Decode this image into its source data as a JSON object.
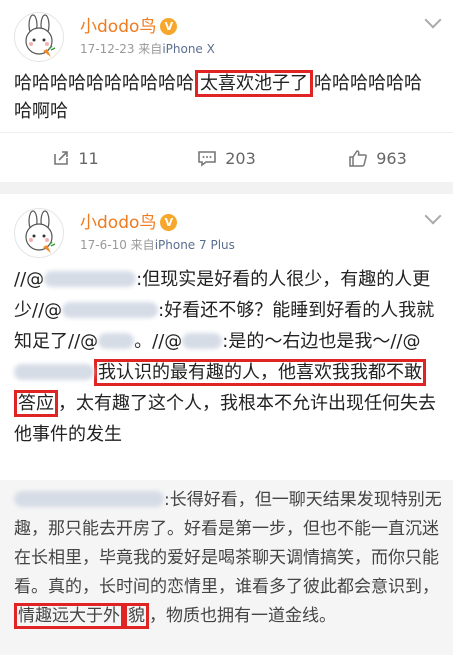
{
  "post1": {
    "user_name": "小dodo鸟",
    "date": "17-12-23",
    "source_prefix": "来自",
    "device": "iPhone X",
    "text_before": "哈哈哈哈哈哈哈哈哈哈",
    "text_highlight": "太喜欢池子了",
    "text_after": "哈哈哈哈哈哈哈啊哈",
    "repost_count": "11",
    "comment_count": "203",
    "like_count": "963"
  },
  "post2": {
    "user_name": "小dodo鸟",
    "date": "17-6-10",
    "source_prefix": "来自",
    "device": "iPhone 7 Plus",
    "line1_a": "//@",
    "line1_b": ":但现实是好看的人很少，有趣的人更少//@",
    "line1_c": ":好看还不够？能睡到好看的人我就知足了//@",
    "line1_d": "。//@",
    "line2_a": ":是的～右边也是我～//@",
    "hl_part1": "我认识的最有趣的人，他喜欢我我都不敢",
    "hl_part2": "答应",
    "line3": "，太有趣了这个人，我根本不允许出现任何失去他事件的发生",
    "repost_a": ":长得好看，但一聊天结果发现特别无趣，那只能去开房了。好看是第一步，但也不能一直沉迷在长相里，毕竟我的爱好是喝茶聊天调情搞笑，而你只能看。真的，长时间的恋情里，谁看多了彼此都会意识到，",
    "repost_hl1": "情趣远大于外",
    "repost_hl2": "貌",
    "repost_b": "，物质也拥有一道金线。"
  }
}
